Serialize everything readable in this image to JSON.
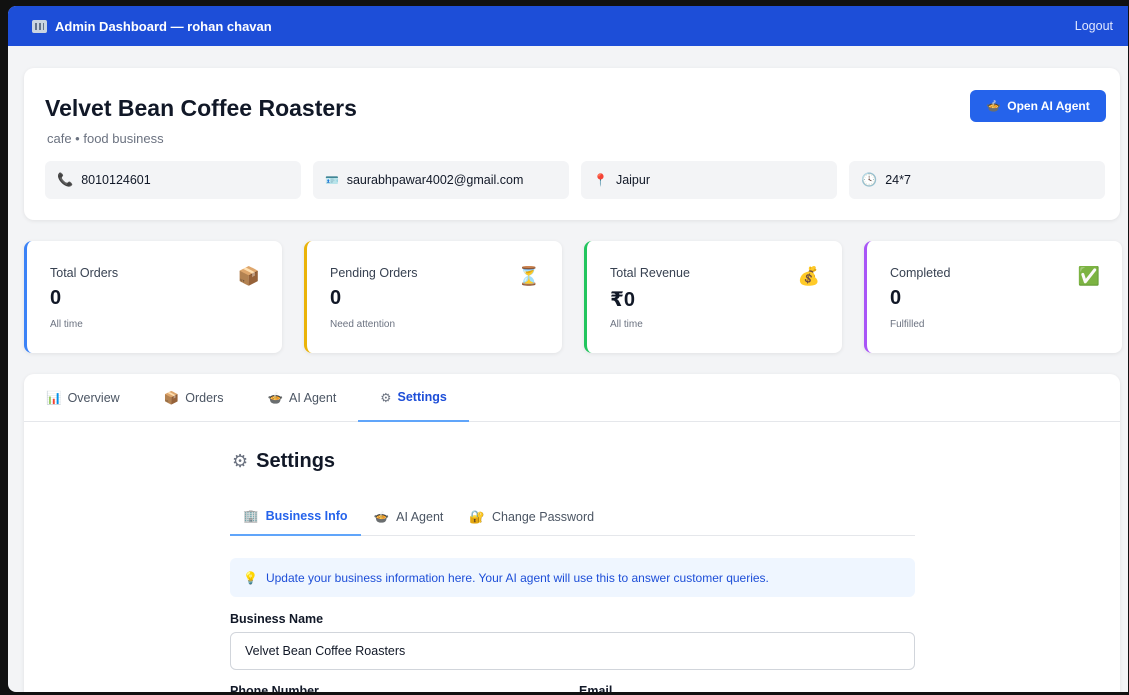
{
  "topbar": {
    "title": "Admin Dashboard — rohan chavan",
    "logout": "Logout"
  },
  "business": {
    "name": "Velvet Bean Coffee Roasters",
    "subtitle": "cafe • food business",
    "open_ai_label": "Open AI Agent",
    "phone": "8010124601",
    "email": "saurabhpawar4002@gmail.com",
    "location": "Jaipur",
    "hours": "24*7"
  },
  "stats": [
    {
      "label": "Total Orders",
      "value": "0",
      "sub": "All time",
      "icon": "📦",
      "color": "#3b82f6"
    },
    {
      "label": "Pending Orders",
      "value": "0",
      "sub": "Need attention",
      "icon": "⏳",
      "color": "#eab308"
    },
    {
      "label": "Total Revenue",
      "value": "₹0",
      "sub": "All time",
      "icon": "💰",
      "color": "#22c55e"
    },
    {
      "label": "Completed",
      "value": "0",
      "sub": "Fulfilled",
      "icon": "✅",
      "color": "#a855f7"
    }
  ],
  "tabs": [
    {
      "label": "Overview",
      "icon": "📊"
    },
    {
      "label": "Orders",
      "icon": "📦"
    },
    {
      "label": "AI Agent",
      "icon": "🍲"
    },
    {
      "label": "Settings",
      "icon": "⚙"
    }
  ],
  "settings": {
    "title": "Settings",
    "subtabs": [
      {
        "label": "Business Info",
        "icon": "🏢"
      },
      {
        "label": "AI Agent",
        "icon": "🍲"
      },
      {
        "label": "Change Password",
        "icon": "🔐"
      }
    ],
    "notice": "Update your business information here. Your AI agent will use this to answer customer queries.",
    "business_name_label": "Business Name",
    "business_name_value": "Velvet Bean Coffee Roasters",
    "phone_label": "Phone Number",
    "email_label": "Email"
  }
}
